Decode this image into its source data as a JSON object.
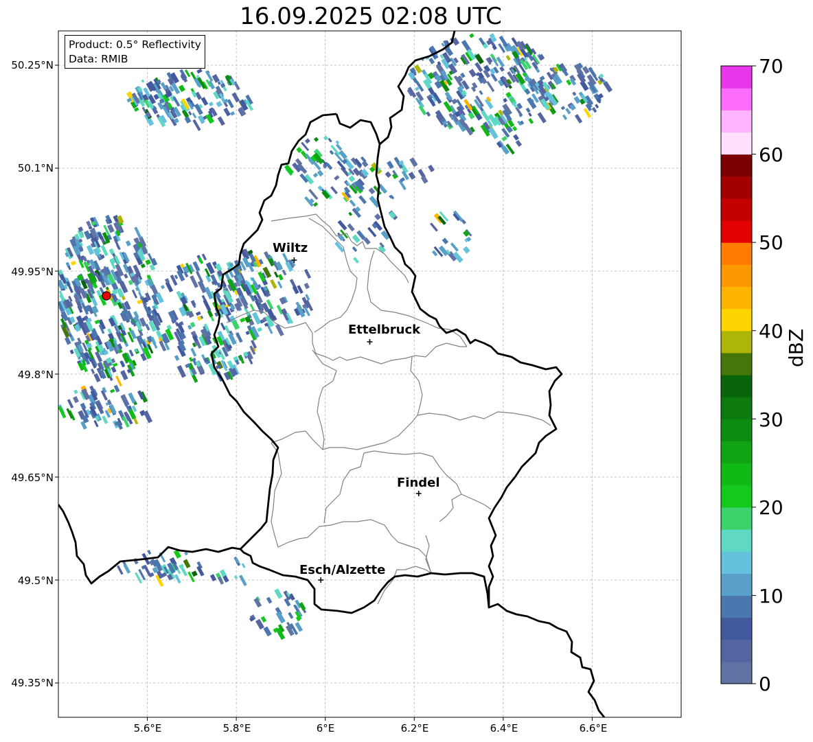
{
  "title": "16.09.2025 02:08 UTC",
  "info": {
    "product": "Product: 0.5° Reflectivity",
    "data": "Data: RMIB"
  },
  "axes": {
    "lat_ticks": [
      "50.25°N",
      "50.1°N",
      "49.95°N",
      "49.8°N",
      "49.65°N",
      "49.5°N",
      "49.35°N"
    ],
    "lon_ticks": [
      "5.6°E",
      "5.8°E",
      "6°E",
      "6.2°E",
      "6.4°E",
      "6.6°E"
    ],
    "lon_range": [
      5.4,
      6.8
    ],
    "lat_range": [
      49.3,
      50.3
    ]
  },
  "cities": [
    {
      "name": "Wiltz",
      "lon": 5.93,
      "lat": 49.966
    },
    {
      "name": "Ettelbruck",
      "lon": 6.1,
      "lat": 49.847
    },
    {
      "name": "Findel",
      "lon": 6.21,
      "lat": 49.626
    },
    {
      "name": "Esch/Alzette",
      "lon": 5.99,
      "lat": 49.5
    }
  ],
  "radar_site": {
    "lon": 5.505,
    "lat": 49.914
  },
  "colorbar": {
    "label": "dBZ",
    "ticks": [
      "70",
      "60",
      "50",
      "40",
      "30",
      "20",
      "10",
      "0"
    ],
    "min": 0,
    "max": 70,
    "colors": [
      "#6172a4",
      "#5565a1",
      "#42599d",
      "#4b77ae",
      "#58a0c8",
      "#64c2dc",
      "#5fd8c4",
      "#3dd36c",
      "#12c91c",
      "#10b916",
      "#10a314",
      "#0d8d10",
      "#0c7a0f",
      "#096509",
      "#46760a",
      "#adb506",
      "#ffd500",
      "#fdb500",
      "#fd9900",
      "#ff7c00",
      "#e20000",
      "#c20000",
      "#a20000",
      "#7a0000",
      "#ffe0ff",
      "#ffb4ff",
      "#ff6dff",
      "#ea36ea"
    ]
  },
  "colors": {
    "country_border": "#000000",
    "canton_border": "#808080",
    "radar_dot": "#e60000"
  }
}
